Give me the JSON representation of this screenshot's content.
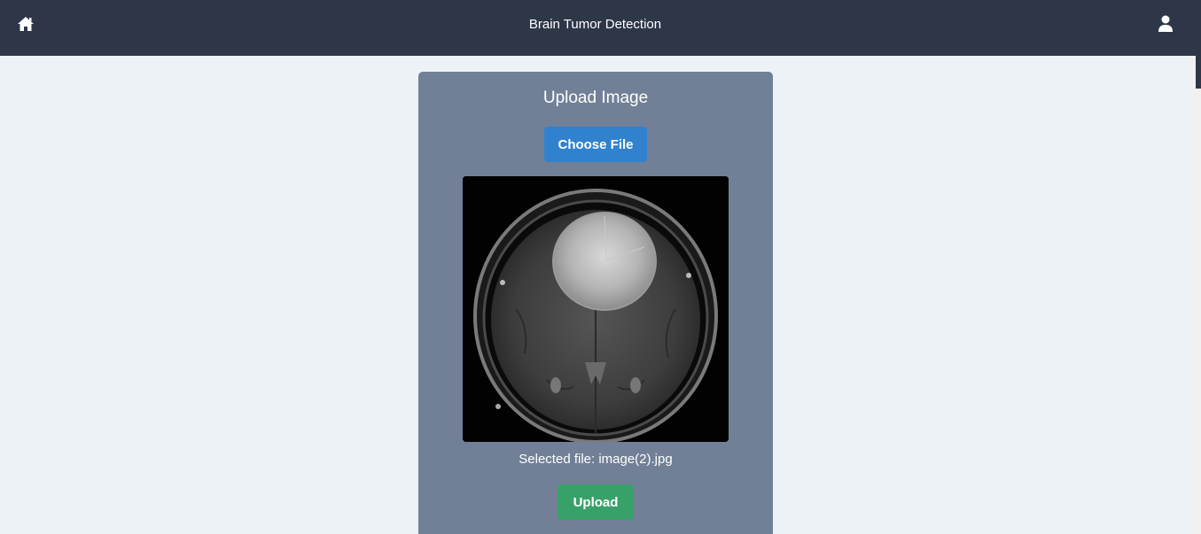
{
  "navbar": {
    "title": "Brain Tumor Detection",
    "home_icon": "home-icon",
    "user_icon": "user-icon",
    "background": "#2d3748"
  },
  "upload_card": {
    "heading": "Upload Image",
    "choose_file_label": "Choose File",
    "selected_file_text": "Selected file: image(2).jpg",
    "upload_label": "Upload",
    "preview_image": "brain-mri-scan",
    "card_color": "#718096",
    "choose_file_color": "#3182ce",
    "upload_color": "#38a169"
  },
  "page": {
    "background": "#edf2f7"
  }
}
